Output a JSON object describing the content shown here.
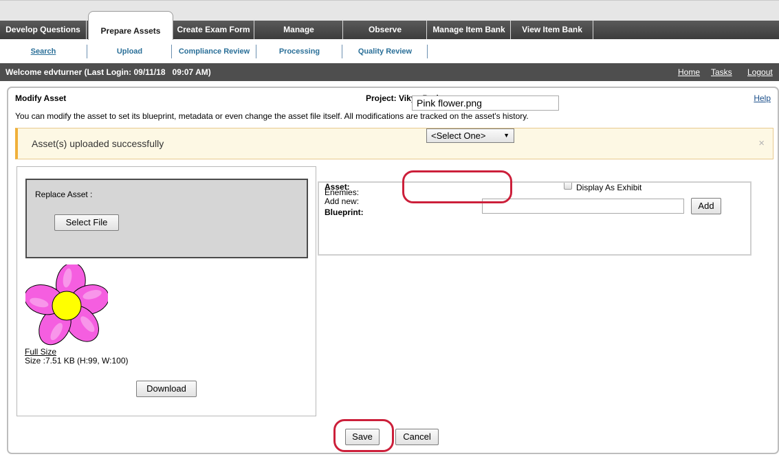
{
  "nav": {
    "tabs": [
      {
        "label": "Develop Questions"
      },
      {
        "label": "Prepare Assets"
      },
      {
        "label": "Create Exam Form"
      },
      {
        "label": "Manage"
      },
      {
        "label": "Observe"
      },
      {
        "label": "Manage Item Bank"
      },
      {
        "label": "View Item Bank"
      }
    ],
    "active_tab": "Prepare Assets"
  },
  "subnav": {
    "items": [
      {
        "label": "Search"
      },
      {
        "label": "Upload"
      },
      {
        "label": "Compliance Review"
      },
      {
        "label": "Processing"
      },
      {
        "label": "Quality Review"
      }
    ],
    "active_item": "Search"
  },
  "welcome": {
    "text": "Welcome edvturner (Last Login: 09/11/18   09:07 AM)",
    "links": {
      "home": "Home",
      "tasks": "Tasks",
      "logout": "Logout"
    }
  },
  "page": {
    "title": "Modify Asset",
    "project": "Project: Vikys Project",
    "help": "Help",
    "description": "You can modify the asset to set its blueprint, metadata or even change the asset file itself. All modifications are tracked on the asset's history.",
    "alert": "Asset(s) uploaded successfully",
    "alert_close": "×"
  },
  "left": {
    "replace_label": "Replace Asset :",
    "select_file": "Select File",
    "full_size": "Full Size",
    "size": "Size :7.51 KB (H:99, W:100)",
    "download": "Download"
  },
  "form": {
    "asset_label": "Asset:",
    "asset_value": "Pink flower.png",
    "display_exhibit": "Display As Exhibit",
    "blueprint_label": "Blueprint:",
    "blueprint_value": "<Select One>",
    "enemies_label": "Enemies:",
    "add_new_label": "Add new:",
    "add_button": "Add",
    "enemies_input_value": ""
  },
  "actions": {
    "save": "Save",
    "cancel": "Cancel"
  },
  "colors": {
    "navbar": "#4a4a4a",
    "link": "#2a6f98",
    "alert_accent": "#f0b03a",
    "highlight": "#cc1f3a",
    "petal": "#f55ee0",
    "flower_center": "#ffff00"
  }
}
